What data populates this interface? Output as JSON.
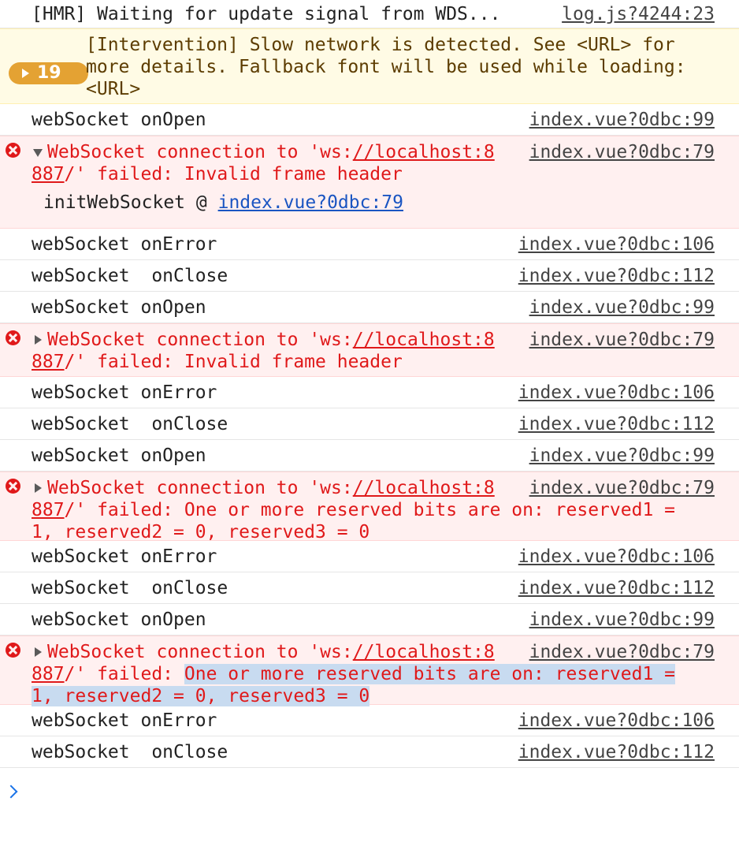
{
  "hmr": {
    "message": "[HMR] Waiting for update signal from WDS...",
    "source": "log.js?4244:23"
  },
  "warning": {
    "count": "19",
    "message": "[Intervention] Slow network is detected. See <URL> for more details. Fallback font will be used while loading: <URL>"
  },
  "entries": [
    {
      "type": "info",
      "message": "webSocket onOpen",
      "source": "index.vue?0dbc:99"
    },
    {
      "type": "error",
      "expanded": true,
      "prefix": "WebSocket connection to 'ws:",
      "link1": "//localhost:8",
      "link2": "887",
      "rest1": "/' failed: Invalid frame header",
      "source": "index.vue?0dbc:79",
      "trace_fn": "initWebSocket",
      "trace_at": "@",
      "trace_link": "index.vue?0dbc:79"
    },
    {
      "type": "info",
      "message": "webSocket onError",
      "source": "index.vue?0dbc:106"
    },
    {
      "type": "info",
      "message": "webSocket  onClose",
      "source": "index.vue?0dbc:112"
    },
    {
      "type": "info",
      "message": "webSocket onOpen",
      "source": "index.vue?0dbc:99"
    },
    {
      "type": "error",
      "expanded": false,
      "prefix": "WebSocket connection to 'ws:",
      "link1": "//localhost:8",
      "link2": "887",
      "rest1": "/' failed: Invalid frame header",
      "source": "index.vue?0dbc:79"
    },
    {
      "type": "info",
      "message": "webSocket onError",
      "source": "index.vue?0dbc:106"
    },
    {
      "type": "info",
      "message": "webSocket  onClose",
      "source": "index.vue?0dbc:112"
    },
    {
      "type": "info",
      "message": "webSocket onOpen",
      "source": "index.vue?0dbc:99"
    },
    {
      "type": "error",
      "expanded": false,
      "prefix": "WebSocket connection to 'ws:",
      "link1": "//localhost:8",
      "link2": "887",
      "rest1": "/' failed: One or more reserved bits are on: reserved1 =",
      "rest2": "1, reserved2 = 0, reserved3 = 0",
      "source": "index.vue?0dbc:79"
    },
    {
      "type": "info",
      "message": "webSocket onError",
      "source": "index.vue?0dbc:106"
    },
    {
      "type": "info",
      "message": "webSocket  onClose",
      "source": "index.vue?0dbc:112"
    },
    {
      "type": "info",
      "message": "webSocket onOpen",
      "source": "index.vue?0dbc:99"
    },
    {
      "type": "error",
      "expanded": false,
      "prefix": "WebSocket connection to 'ws:",
      "link1": "//localhost:8",
      "link2": "887",
      "rest1a": "/' failed: ",
      "rest1b": "One or more reserved bits are on: reserved1 =",
      "rest2": "1, reserved2 = 0, reserved3 = 0",
      "source": "index.vue?0dbc:79"
    },
    {
      "type": "info",
      "message": "webSocket onError",
      "source": "index.vue?0dbc:106"
    },
    {
      "type": "info",
      "message": "webSocket  onClose",
      "source": "index.vue?0dbc:112"
    }
  ],
  "colors": {
    "error": "#e0191a",
    "warning_bg": "#fffbe5",
    "error_bg": "#fff0f0",
    "selection": "#c8dbf0",
    "prompt": "#1a73e8"
  },
  "icons": [
    "error-icon",
    "expand-triangle-icon",
    "collapse-triangle-icon",
    "prompt-chevron-icon"
  ]
}
